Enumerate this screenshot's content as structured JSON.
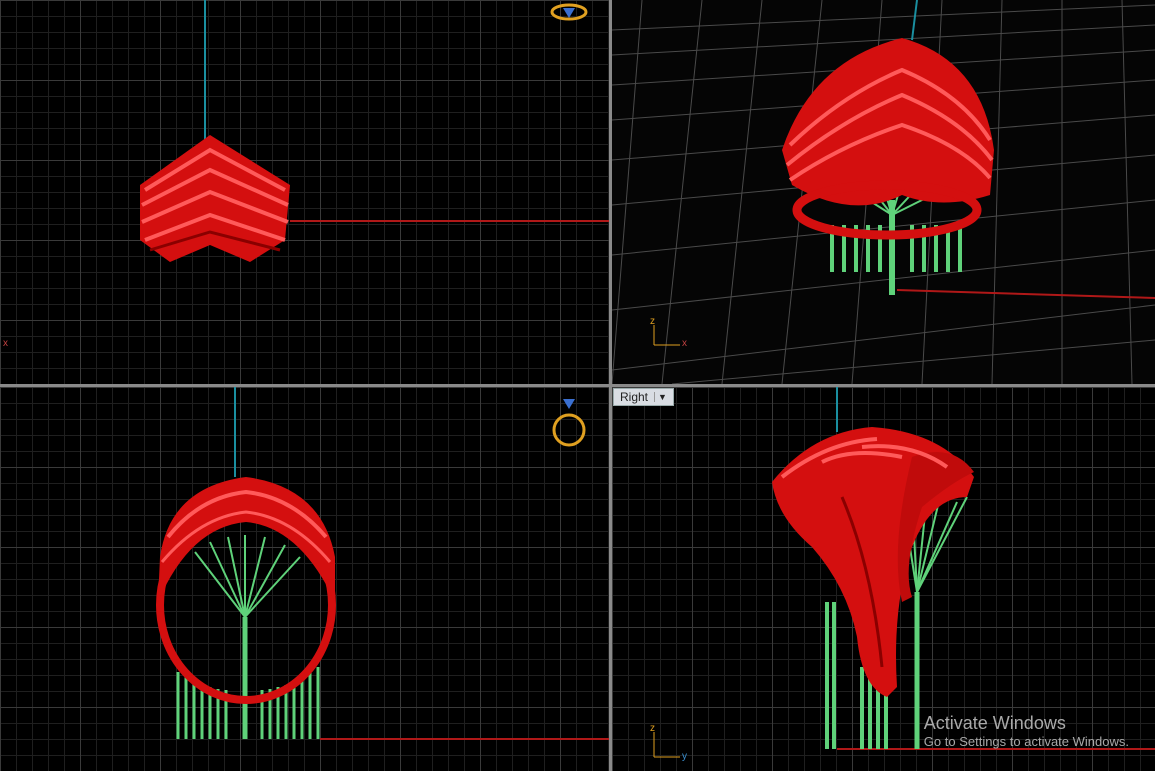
{
  "viewports": {
    "top": {
      "axis_label": "x"
    },
    "perspective": {
      "axis_z": "z",
      "axis_x": "x"
    },
    "front": {},
    "right": {
      "label": "Right",
      "axis_z": "z",
      "axis_y": "y"
    }
  },
  "watermark": {
    "title": "Activate Windows",
    "subtitle": "Go to Settings to activate Windows."
  },
  "colors": {
    "model": "#e01010",
    "supports": "#5fd27a",
    "grid": "#3a3a3a",
    "x_axis": "#b01818",
    "z_axis": "#1a8fa0"
  },
  "icons": [
    "ring-gizmo-icon",
    "ring-front-gizmo-icon",
    "axis-triad-icon",
    "dropdown-arrow-icon"
  ]
}
